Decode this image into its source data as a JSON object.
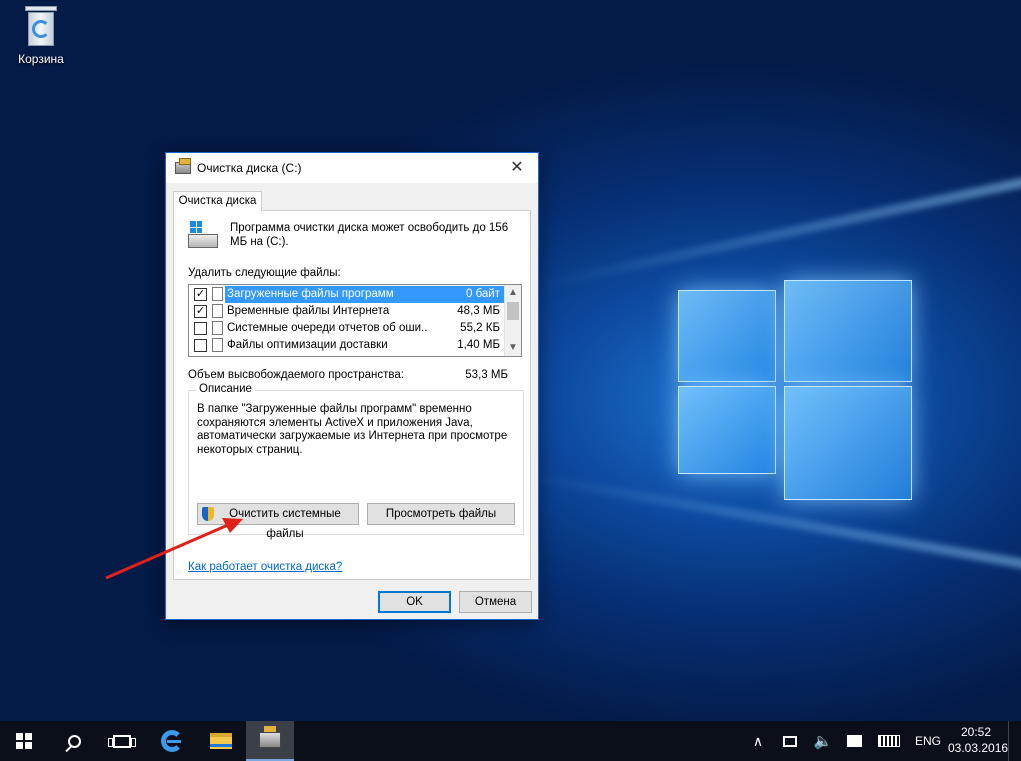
{
  "desktop": {
    "recycle_bin_label": "Корзина"
  },
  "dialog": {
    "title": "Очистка диска  (C:)",
    "tab_label": "Очистка диска",
    "intro_text": "Программа очистки диска может освободить до 156 МБ на  (C:).",
    "files_to_delete_label": "Удалить следующие файлы:",
    "files": [
      {
        "checked": true,
        "name": "Загруженные файлы программ",
        "size": "0 байт",
        "selected": true
      },
      {
        "checked": true,
        "name": "Временные файлы Интернета",
        "size": "48,3 МБ",
        "selected": false
      },
      {
        "checked": false,
        "name": "Системные очереди отчетов об оши...",
        "size": "55,2 КБ",
        "selected": false
      },
      {
        "checked": false,
        "name": "Файлы оптимизации доставки",
        "size": "1,40 МБ",
        "selected": false
      }
    ],
    "space_label": "Объем высвобождаемого пространства:",
    "space_value": "53,3 МБ",
    "description_group_title": "Описание",
    "description_text": "В папке \"Загруженные файлы программ\" временно сохраняются элементы ActiveX и приложения Java, автоматически загружаемые из Интернета при просмотре некоторых страниц.",
    "clean_system_button": "Очистить системные файлы",
    "view_files_button": "Просмотреть файлы",
    "help_link": "Как работает очистка диска?",
    "ok_button": "OK",
    "cancel_button": "Отмена",
    "close_glyph": "✕"
  },
  "taskbar": {
    "language": "ENG",
    "time": "20:52",
    "date": "03.03.2016",
    "tray_chevron": "∧",
    "volume_glyph": "🔈"
  },
  "colors": {
    "accent": "#0078d7",
    "selection": "#3399ff",
    "link": "#0066cc",
    "arrow": "#e0201b"
  },
  "icons": [
    "recycle-bin-icon",
    "disk-cleanup-icon",
    "hard-drive-icon",
    "shield-icon",
    "start-icon",
    "search-icon",
    "task-view-icon",
    "edge-icon",
    "file-explorer-icon",
    "network-icon",
    "volume-icon",
    "action-center-icon",
    "keyboard-icon"
  ]
}
